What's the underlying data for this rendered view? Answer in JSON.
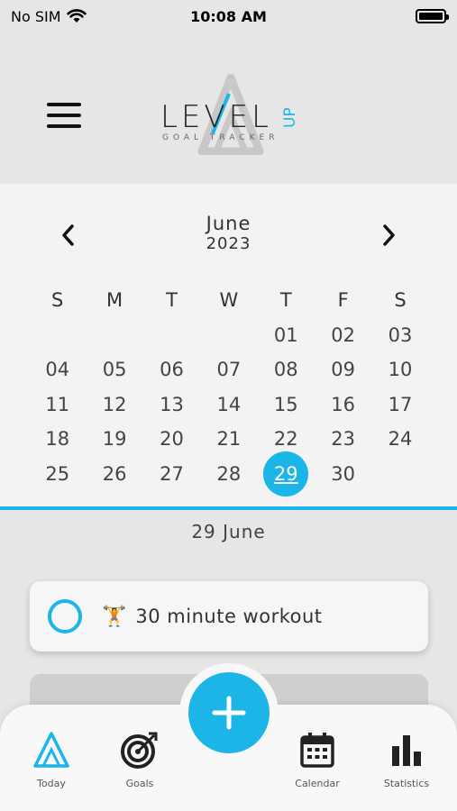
{
  "status_bar": {
    "carrier": "No SIM",
    "time": "10:08 AM"
  },
  "logo": {
    "main": "LEVEL",
    "accent": "UP",
    "sub": "GOAL TRACKER"
  },
  "calendar": {
    "month": "June",
    "year": "2023",
    "weekdays": [
      "S",
      "M",
      "T",
      "W",
      "T",
      "F",
      "S"
    ],
    "days": [
      "",
      "",
      "",
      "",
      "01",
      "02",
      "03",
      "04",
      "05",
      "06",
      "07",
      "08",
      "09",
      "10",
      "11",
      "12",
      "13",
      "14",
      "15",
      "16",
      "17",
      "18",
      "19",
      "20",
      "21",
      "22",
      "23",
      "24",
      "25",
      "26",
      "27",
      "28",
      "29",
      "30",
      ""
    ],
    "selected": "29"
  },
  "selected_date_label": "29 June",
  "tasks": [
    {
      "emoji": "🏋",
      "title": "30 minute workout"
    }
  ],
  "nav": {
    "today": "Today",
    "goals": "Goals",
    "calendar": "Calendar",
    "statistics": "Statistics"
  },
  "colors": {
    "accent": "#1bb5e8"
  }
}
